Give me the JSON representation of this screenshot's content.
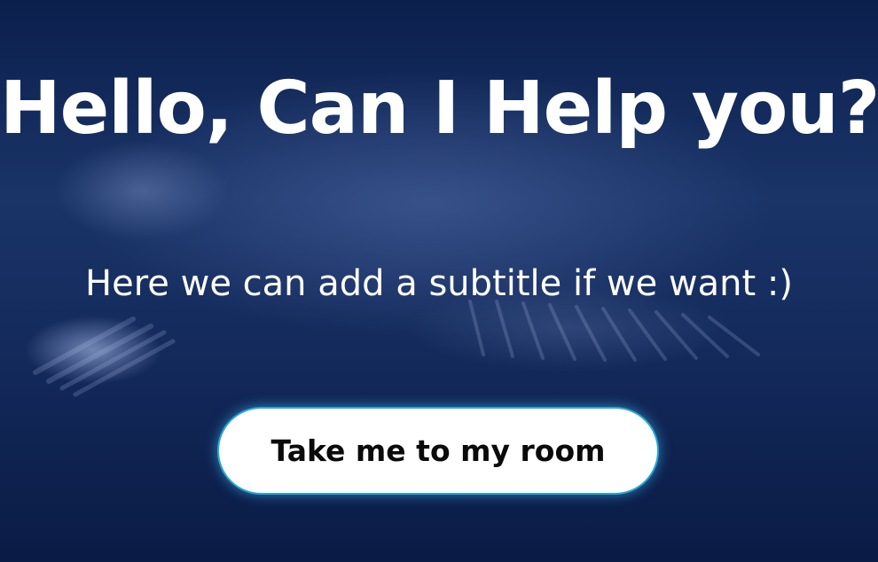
{
  "hero": {
    "title": "Hello, Can I Help you?",
    "subtitle": "Here we can add a subtitle if we want :)",
    "cta_label": "Take me to my room"
  },
  "colors": {
    "background": "#13295a",
    "text": "#ffffff",
    "button_bg": "#ffffff",
    "button_border": "#2aa7d6",
    "button_text": "#0a0a0a"
  }
}
